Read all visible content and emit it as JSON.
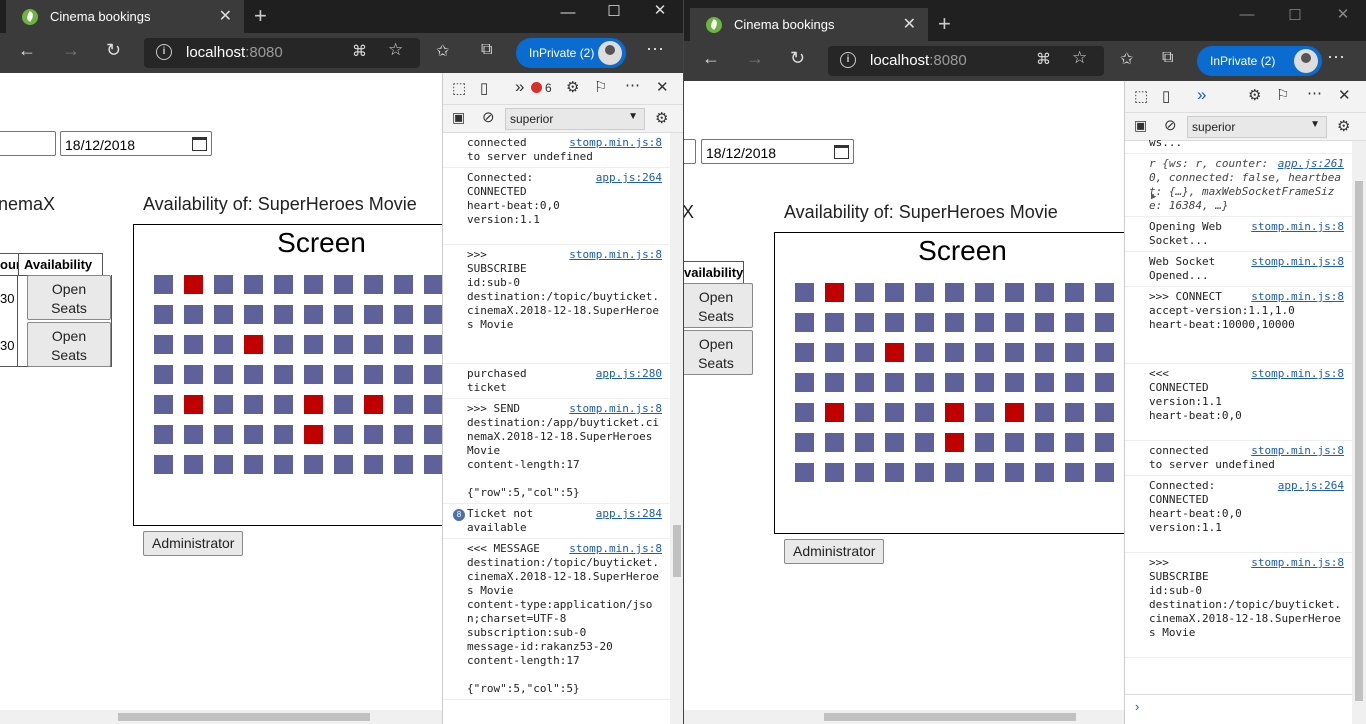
{
  "app": {
    "tab_title": "Cinema bookings",
    "url_host": "localhost",
    "url_port": ":8080",
    "inprivate_label": "InPrivate (2)",
    "close_glyph": "✕",
    "newtab_glyph": "+",
    "minimize_glyph": "—",
    "maximize_glyph": "☐",
    "info_glyph": "i",
    "colors": {
      "seat_free": "#5f619a",
      "seat_taken": "#c00000",
      "inprivate": "#0a6bd0"
    }
  },
  "booking": {
    "date": "18/12/2018",
    "cinema_fragment": "nemaX",
    "cinema_fragment2": "X",
    "availability_title": "Availability of: SuperHeroes Movie",
    "screen_label": "Screen",
    "col_hour_fragment": "our",
    "col_availability": "Availability",
    "col_availability2": "vailability",
    "row_hour_fragment": "30",
    "open_seats_label": "Open Seats",
    "admin_label": "Administrator",
    "seats": {
      "rows": 7,
      "cols": 11,
      "taken": [
        [
          0,
          1
        ],
        [
          2,
          3
        ],
        [
          4,
          1
        ],
        [
          4,
          5
        ],
        [
          4,
          7
        ],
        [
          5,
          5
        ]
      ]
    }
  },
  "devtools": {
    "error_count": "6",
    "filter_value": "superior",
    "more_glyph": "»",
    "log_w1": [
      {
        "text": "connected\nto server undefined",
        "src": "stomp.min.js:8",
        "badge": ""
      },
      {
        "text": "Connected:\nCONNECTED\nheart-beat:0,0\nversion:1.1\n ",
        "src": "app.js:264",
        "badge": ""
      },
      {
        "text": ">>>\nSUBSCRIBE\nid:sub-0\ndestination:/topic/buyticket.cinemaX.2018-12-18.SuperHeroes Movie\n\n ",
        "src": "stomp.min.js:8",
        "badge": ""
      },
      {
        "text": "purchased\nticket",
        "src": "app.js:280",
        "badge": ""
      },
      {
        "text": ">>> SEND\ndestination:/app/buyticket.cinemaX.2018-12-18.SuperHeroes Movie\ncontent-length:17\n\n{\"row\":5,\"col\":5}",
        "src": "stomp.min.js:8",
        "badge": ""
      },
      {
        "text": "Ticket not\navailable",
        "src": "app.js:284",
        "badge": "8"
      },
      {
        "text": "<<< MESSAGE\ndestination:/topic/buyticket.cinemaX.2018-12-18.SuperHeroes Movie\ncontent-type:application/json;charset=UTF-8\nsubscription:sub-0\nmessage-id:rakanz53-20\ncontent-length:17\n\n{\"row\":5,\"col\":5}",
        "src": "stomp.min.js:8",
        "badge": ""
      }
    ],
    "log_w2": [
      {
        "text": "ws...",
        "src": "",
        "badge": ""
      },
      {
        "text": "r {ws: r, counter: 0, connected: false, heartbeat: {…}, maxWebSocketFrameSize: 16384, …}",
        "src": "app.js:261",
        "badge": "",
        "obj": true
      },
      {
        "text": "Opening Web\nSocket...",
        "src": "stomp.min.js:8",
        "badge": ""
      },
      {
        "text": "Web Socket\nOpened...",
        "src": "stomp.min.js:8",
        "badge": ""
      },
      {
        "text": ">>> CONNECT\naccept-version:1.1,1.0\nheart-beat:10000,10000\n\n ",
        "src": "stomp.min.js:8",
        "badge": ""
      },
      {
        "text": "<<<\nCONNECTED\nversion:1.1\nheart-beat:0,0\n ",
        "src": "stomp.min.js:8",
        "badge": ""
      },
      {
        "text": "connected\nto server undefined",
        "src": "stomp.min.js:8",
        "badge": ""
      },
      {
        "text": "Connected:\nCONNECTED\nheart-beat:0,0\nversion:1.1\n ",
        "src": "app.js:264",
        "badge": ""
      },
      {
        "text": ">>>\nSUBSCRIBE\nid:sub-0\ndestination:/topic/buyticket.cinemaX.2018-12-18.SuperHeroes Movie\n ",
        "src": "stomp.min.js:8",
        "badge": ""
      }
    ],
    "prompt_glyph": "›"
  }
}
